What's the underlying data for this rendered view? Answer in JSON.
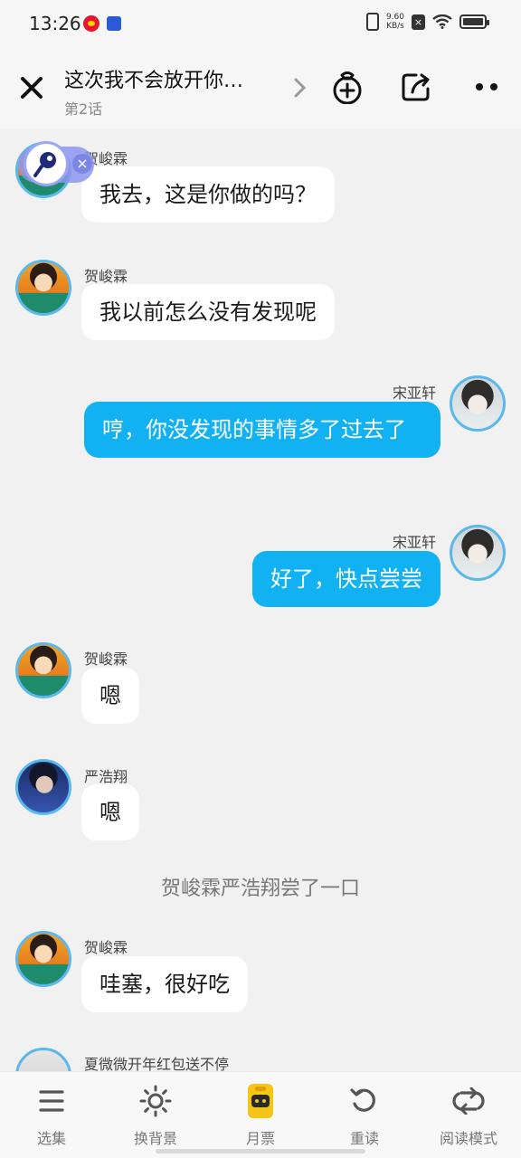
{
  "status_bar": {
    "time": "13:26",
    "net_speed_value": "9.60",
    "net_speed_unit": "KB/s",
    "battery_level": 1.0
  },
  "header": {
    "title": "这次我不会放开你…",
    "episode": "第2话"
  },
  "messages": [
    {
      "side": "left",
      "sender": "贺峻霖",
      "avatar": "avatar-he",
      "text": "我去，这是你做的吗？"
    },
    {
      "side": "left",
      "sender": "贺峻霖",
      "avatar": "avatar-he",
      "text": "我以前怎么没有发现呢"
    },
    {
      "side": "right",
      "sender": "宋亚轩",
      "avatar": "avatar-song",
      "text": "哼，你没发现的事情多了过去了"
    },
    {
      "side": "right",
      "sender": "宋亚轩",
      "avatar": "avatar-song",
      "text": "好了，快点尝尝"
    },
    {
      "side": "left",
      "sender": "贺峻霖",
      "avatar": "avatar-he",
      "text": "嗯"
    },
    {
      "side": "left",
      "sender": "严浩翔",
      "avatar": "avatar-yan",
      "text": "嗯"
    },
    {
      "narration": "贺峻霖严浩翔尝了一口"
    },
    {
      "side": "left",
      "sender": "贺峻霖",
      "avatar": "avatar-he",
      "text": "哇塞，很好吃"
    },
    {
      "side": "left",
      "sender": "夏微微开年红包送不停",
      "avatar": "avatar-xia",
      "text": ""
    }
  ],
  "bottom_bar": {
    "items": [
      {
        "label": "选集",
        "icon": "list-icon"
      },
      {
        "label": "换背景",
        "icon": "sun-icon"
      },
      {
        "label": "月票",
        "icon": "ticket-icon"
      },
      {
        "label": "重读",
        "icon": "replay-icon"
      },
      {
        "label": "阅读模式",
        "icon": "loop-icon"
      }
    ]
  },
  "colors": {
    "accent": "#12b2f2",
    "avatar_ring": "#5cb7ec",
    "background": "#f1f1f1"
  }
}
